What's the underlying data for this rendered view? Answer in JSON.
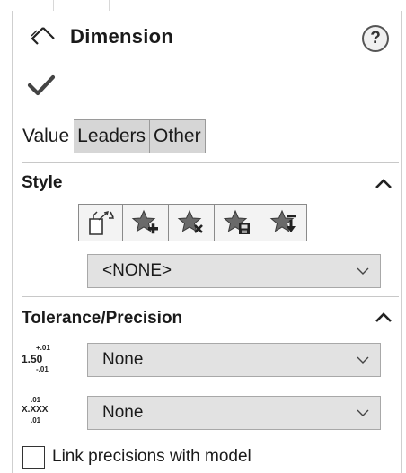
{
  "header": {
    "title": "Dimension",
    "help_label": "?"
  },
  "tabs": [
    {
      "label": "Value",
      "active": true
    },
    {
      "label": "Leaders",
      "active": false
    },
    {
      "label": "Other",
      "active": false
    }
  ],
  "style_section": {
    "title": "Style",
    "buttons": [
      "apply-default-attributes-icon",
      "add-style-icon",
      "delete-style-icon",
      "save-style-icon",
      "load-style-icon"
    ],
    "select_value": "<NONE>"
  },
  "tolerance_section": {
    "title": "Tolerance/Precision",
    "tolerance_icon": {
      "plus": "+.01",
      "nominal": "1.50",
      "minus": "-.01"
    },
    "tolerance_select": "None",
    "precision_icon": {
      "top": ".01",
      "nominal": "X.XXX",
      "bottom": ".01"
    },
    "precision_select": "None"
  },
  "link_precisions": {
    "label": "Link precisions with model",
    "checked": false
  },
  "colors": {
    "inactive_tab": "#d6d6d6",
    "select_bg": "#e2e2e2",
    "button_bg": "#f3f3f3",
    "border": "#9a9a9a"
  }
}
